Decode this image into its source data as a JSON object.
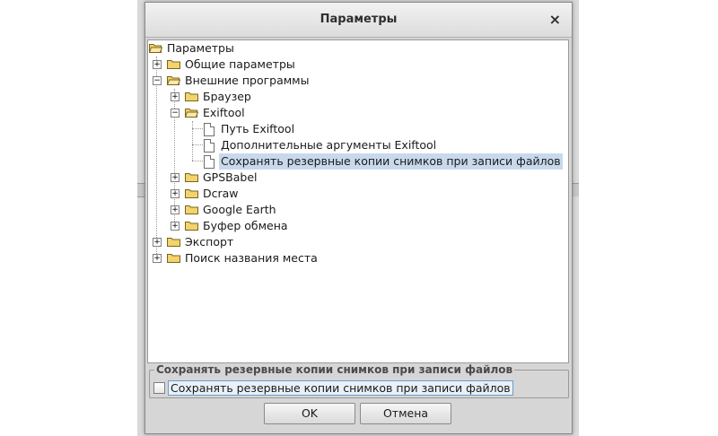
{
  "dialog": {
    "title": "Параметры",
    "close_glyph": "×",
    "ok_label": "OK",
    "cancel_label": "Отмена"
  },
  "tree": {
    "root": "Параметры",
    "general": "Общие параметры",
    "external": "Внешние программы",
    "browser": "Браузер",
    "exiftool": "Exiftool",
    "exiftool_path": "Путь Exiftool",
    "exiftool_args": "Дополнительные аргументы Exiftool",
    "exiftool_backup": "Сохранять резервные копии снимков при записи файлов",
    "gpsbabel": "GPSBabel",
    "dcraw": "Dcraw",
    "google_earth": "Google Earth",
    "clipboard": "Буфер обмена",
    "export": "Экспорт",
    "place_search": "Поиск названия места"
  },
  "panel": {
    "group_title": "Сохранять резервные копии снимков при записи файлов",
    "checkbox_label": "Сохранять резервные копии снимков при записи файлов",
    "checked": false
  },
  "colors": {
    "selection": "#c8d9ec",
    "folder": "#f3d36b",
    "dialog_bg": "#d6d6d6"
  },
  "icons": {
    "folder": "folder-icon",
    "folder_open": "folder-open-icon",
    "document": "document-icon",
    "expand": "expand-icon",
    "collapse": "collapse-icon"
  }
}
